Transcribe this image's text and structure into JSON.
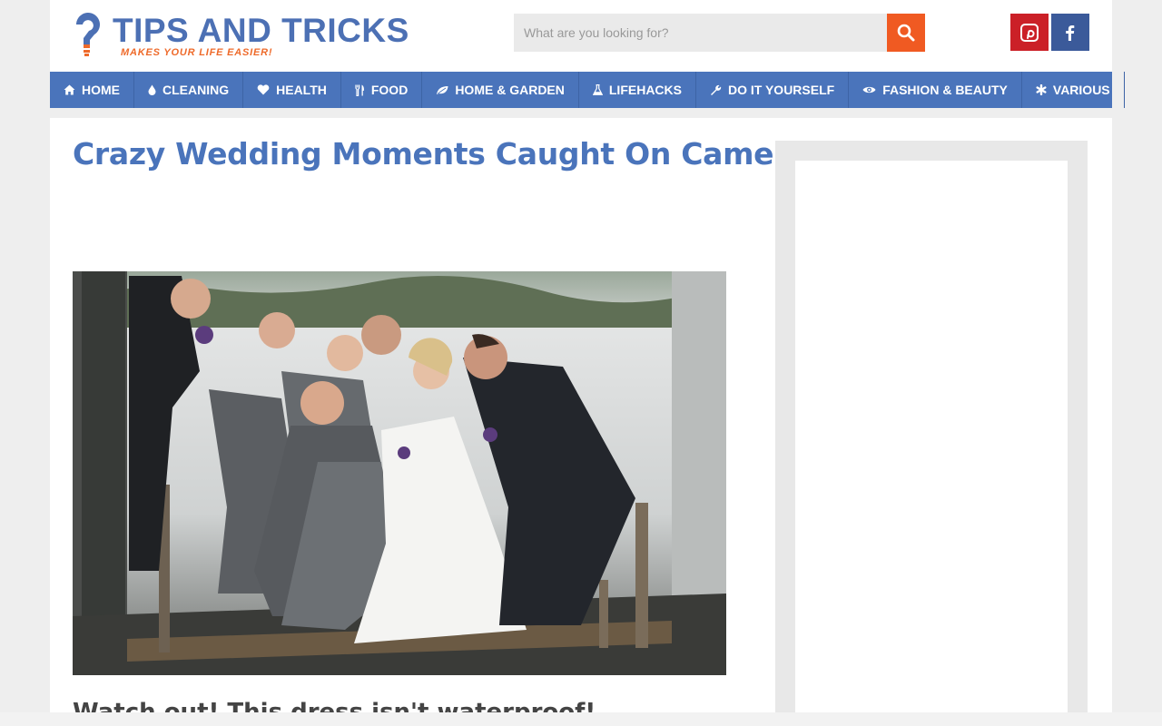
{
  "header": {
    "logo_title": "TIPS AND TRICKS",
    "logo_tagline": "MAKES YOUR LIFE EASIER!",
    "logo_icon": "lightbulb-question-icon",
    "search": {
      "placeholder": "What are you looking for?",
      "icon": "search-icon"
    },
    "social": [
      {
        "name": "pinterest",
        "icon": "pinterest-icon",
        "color": "#cb2027"
      },
      {
        "name": "facebook",
        "icon": "facebook-icon",
        "color": "#3b5a9a"
      }
    ]
  },
  "nav": {
    "items": [
      {
        "label": "HOME",
        "icon": "home-icon"
      },
      {
        "label": "CLEANING",
        "icon": "drop-icon"
      },
      {
        "label": "HEALTH",
        "icon": "heart-icon"
      },
      {
        "label": "FOOD",
        "icon": "cutlery-icon"
      },
      {
        "label": "HOME & GARDEN",
        "icon": "leaf-icon"
      },
      {
        "label": "LIFEHACKS",
        "icon": "flask-icon"
      },
      {
        "label": "DO IT YOURSELF",
        "icon": "wrench-icon"
      },
      {
        "label": "FASHION & BEAUTY",
        "icon": "eye-icon"
      },
      {
        "label": "VARIOUS",
        "icon": "asterisk-icon"
      }
    ]
  },
  "article": {
    "title": "Crazy Wedding Moments Caught On Camera",
    "subheading": "Watch out! This dress isn't waterproof!"
  },
  "colors": {
    "brand_blue": "#4a74bb",
    "accent_orange": "#f05a22",
    "background": "#eeeeee"
  }
}
